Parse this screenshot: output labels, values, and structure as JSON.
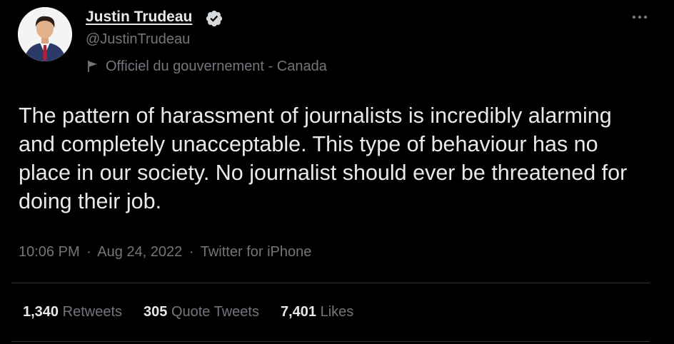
{
  "author": {
    "name": "Justin Trudeau",
    "handle": "@JustinTrudeau",
    "label": "Officiel du gouvernement - Canada",
    "verified": true
  },
  "tweet": {
    "text": "The pattern of harassment of journalists is incredibly alarming and completely unacceptable. This type of behaviour has no place in our society. No journalist should ever be threatened for doing their job.",
    "time": "10:06 PM",
    "date": "Aug 24, 2022",
    "source": "Twitter for iPhone",
    "separator": "·"
  },
  "stats": {
    "retweets_count": "1,340",
    "retweets_label": "Retweets",
    "quotes_count": "305",
    "quotes_label": "Quote Tweets",
    "likes_count": "7,401",
    "likes_label": "Likes"
  },
  "icons": {
    "more": "more-horizontal-icon",
    "verified": "verified-badge-icon",
    "flag": "flag-icon"
  },
  "colors": {
    "background": "#000000",
    "text": "#e7e9ea",
    "muted": "#71767b",
    "divider": "#2f3336"
  }
}
